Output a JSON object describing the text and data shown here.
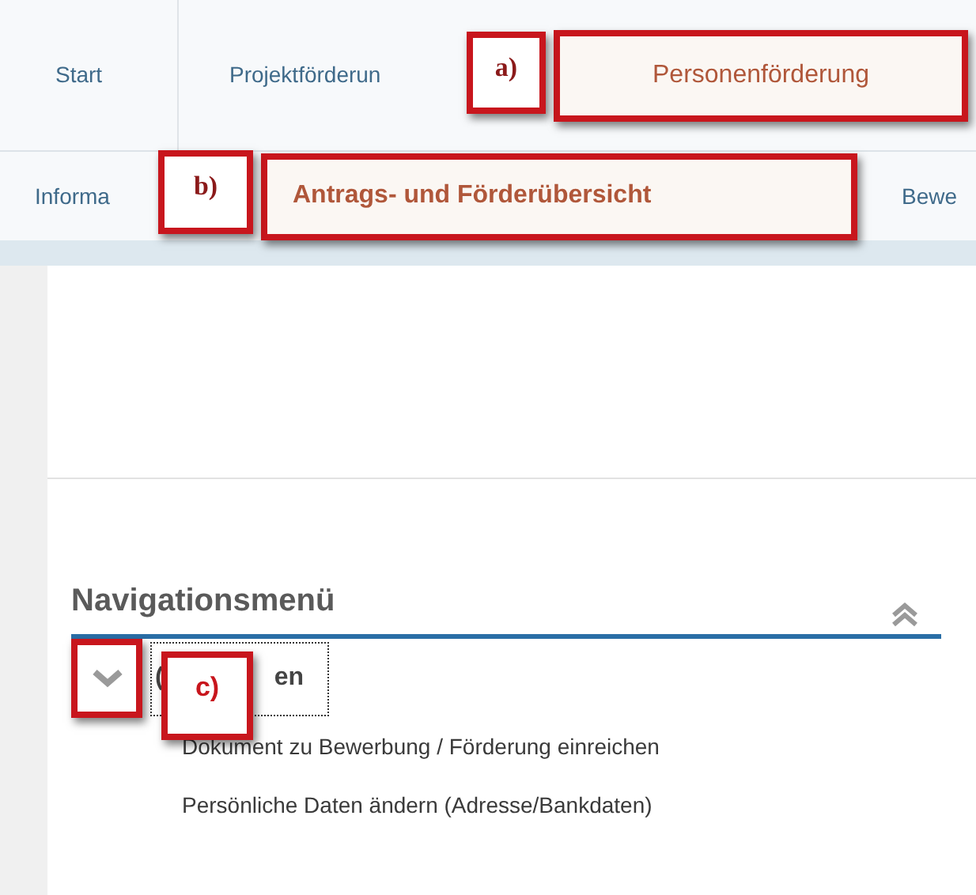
{
  "top_tabs": [
    {
      "label": "Start",
      "selected": false
    },
    {
      "label": "Projektförderun",
      "selected": false
    },
    {
      "label": "Personenförderung",
      "selected": true
    }
  ],
  "sub_tabs": [
    {
      "label": "Informa",
      "selected": false
    },
    {
      "label": "Antrags- und Förderübersicht",
      "selected": true
    },
    {
      "label": "Bewe",
      "selected": false
    }
  ],
  "navigation_menu": {
    "title": "Navigationsmenü",
    "group": {
      "label_start": "(",
      "label_end": "en",
      "expanded": true,
      "items": [
        "Dokument zu Bewerbung / Förderung einreichen",
        "Persönliche Daten ändern (Adresse/Bankdaten)"
      ]
    }
  },
  "callouts": [
    {
      "label": "a)"
    },
    {
      "label": "b)"
    },
    {
      "label": "c)"
    }
  ]
}
